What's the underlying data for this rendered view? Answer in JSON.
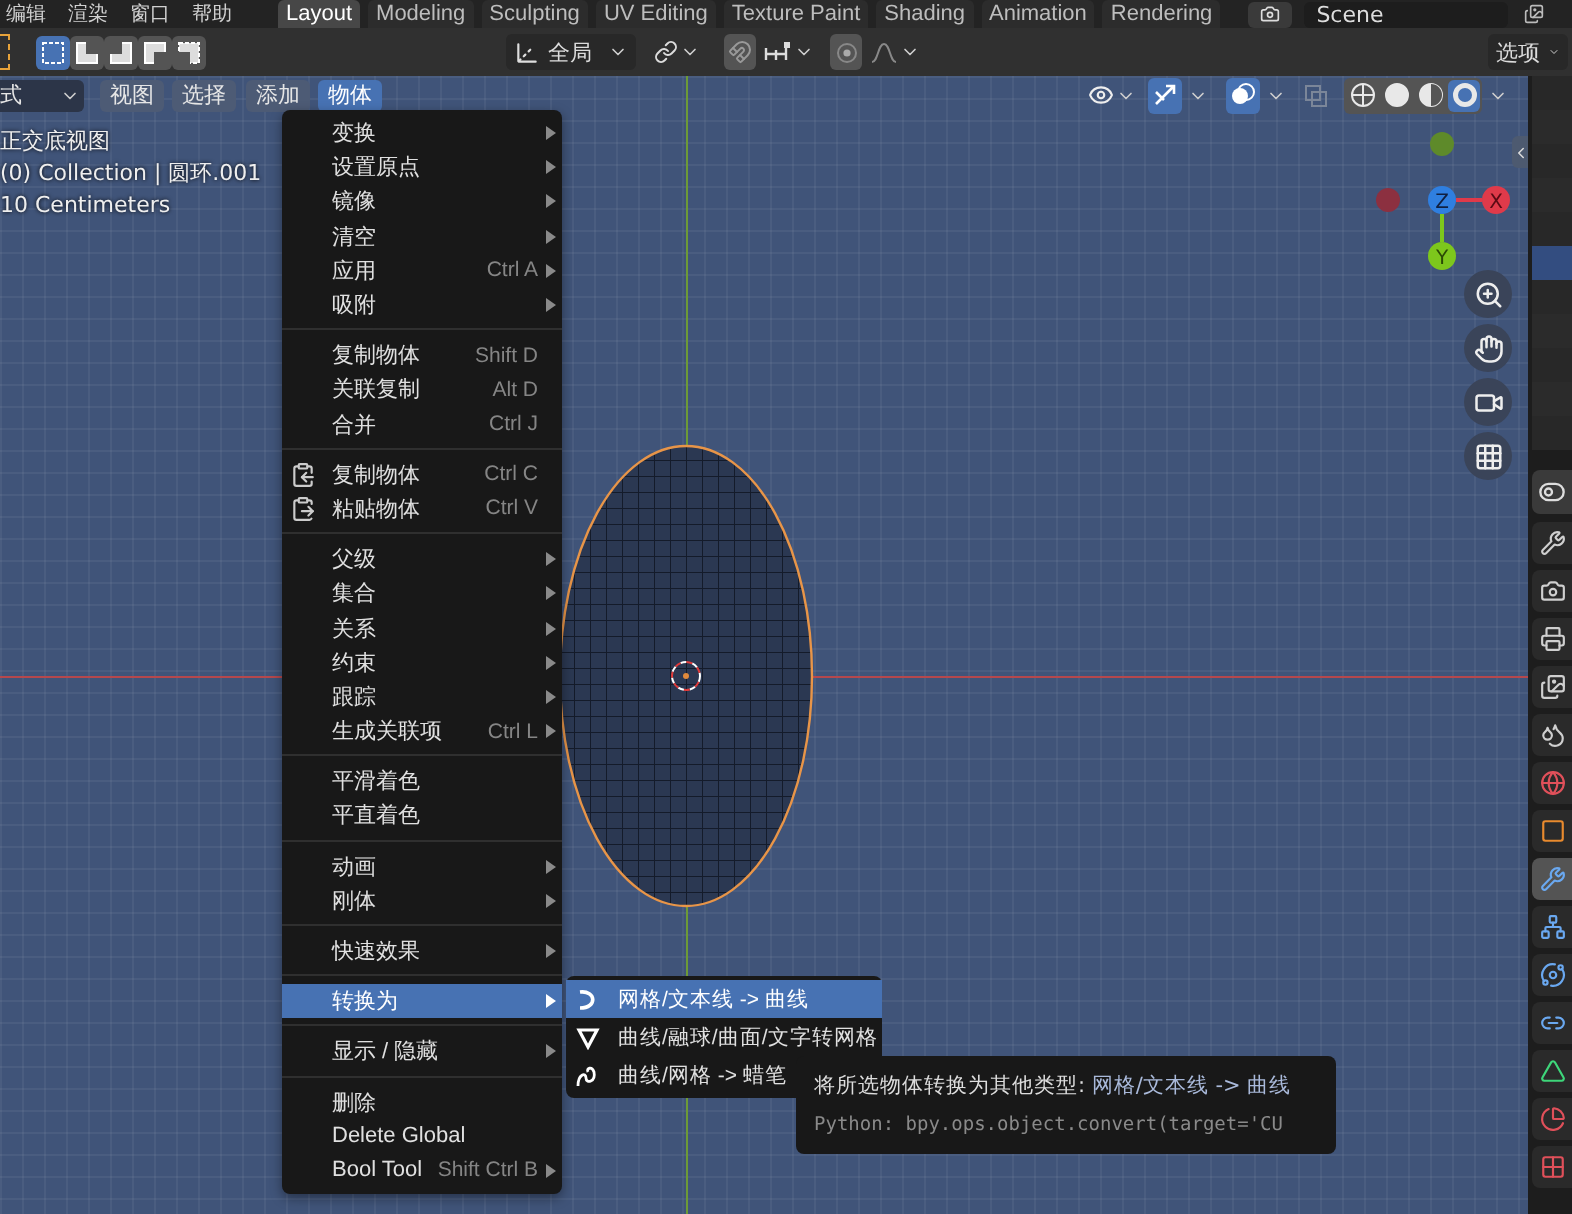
{
  "top_menu": [
    "编辑",
    "渲染",
    "窗口",
    "帮助"
  ],
  "workspace_tabs": [
    {
      "label": "Layout",
      "selected": true
    },
    {
      "label": "Modeling",
      "selected": false
    },
    {
      "label": "Sculpting",
      "selected": false
    },
    {
      "label": "UV Editing",
      "selected": false
    },
    {
      "label": "Texture Paint",
      "selected": false
    },
    {
      "label": "Shading",
      "selected": false
    },
    {
      "label": "Animation",
      "selected": false
    },
    {
      "label": "Rendering",
      "selected": false
    }
  ],
  "scene": {
    "value": "Scene"
  },
  "tool_header": {
    "select_modes": [
      {
        "selected": true
      },
      {
        "selected": false
      },
      {
        "selected": false
      },
      {
        "selected": false
      },
      {
        "selected": false
      }
    ],
    "orientation": "全局",
    "options": "选项"
  },
  "view_header": {
    "mode": "式",
    "menus": [
      {
        "label": "视图",
        "selected": false
      },
      {
        "label": "选择",
        "selected": false
      },
      {
        "label": "添加",
        "selected": false
      },
      {
        "label": "物体",
        "selected": true
      }
    ],
    "gizmos_on": true,
    "overlays_on": true,
    "xray_on": false,
    "shading_modes": [
      {
        "selected": false
      },
      {
        "selected": false
      },
      {
        "selected": false
      },
      {
        "selected": true
      }
    ]
  },
  "viewport_info": [
    "正交底视图",
    "(0) Collection | 圆环.001",
    "10 Centimeters"
  ],
  "gizmo": {
    "axes": [
      {
        "label": "Z"
      },
      {
        "label": "X"
      },
      {
        "label": "Y"
      }
    ]
  },
  "object_menu": {
    "groups": [
      [
        {
          "label": "变换",
          "submenu": true,
          "selected": false
        },
        {
          "label": "设置原点",
          "submenu": true,
          "selected": false
        },
        {
          "label": "镜像",
          "submenu": true,
          "selected": false
        },
        {
          "label": "清空",
          "submenu": true,
          "selected": false
        },
        {
          "label": "应用",
          "shortcut": "Ctrl A",
          "submenu": true,
          "selected": false
        },
        {
          "label": "吸附",
          "submenu": true,
          "selected": false
        }
      ],
      [
        {
          "label": "复制物体",
          "shortcut": "Shift D",
          "submenu": false,
          "selected": false
        },
        {
          "label": "关联复制",
          "shortcut": "Alt D",
          "submenu": false,
          "selected": false
        },
        {
          "label": "合并",
          "shortcut": "Ctrl J",
          "submenu": false,
          "selected": false
        }
      ],
      [
        {
          "label": "复制物体",
          "shortcut": "Ctrl C",
          "submenu": false,
          "selected": false
        },
        {
          "label": "粘贴物体",
          "shortcut": "Ctrl V",
          "submenu": false,
          "selected": false
        }
      ],
      [
        {
          "label": "父级",
          "submenu": true,
          "selected": false
        },
        {
          "label": "集合",
          "submenu": true,
          "selected": false
        },
        {
          "label": "关系",
          "submenu": true,
          "selected": false
        },
        {
          "label": "约束",
          "submenu": true,
          "selected": false
        },
        {
          "label": "跟踪",
          "submenu": true,
          "selected": false
        },
        {
          "label": "生成关联项",
          "shortcut": "Ctrl L",
          "submenu": true,
          "selected": false
        }
      ],
      [
        {
          "label": "平滑着色",
          "submenu": false,
          "selected": false
        },
        {
          "label": "平直着色",
          "submenu": false,
          "selected": false
        }
      ],
      [
        {
          "label": "动画",
          "submenu": true,
          "selected": false
        },
        {
          "label": "刚体",
          "submenu": true,
          "selected": false
        }
      ],
      [
        {
          "label": "快速效果",
          "submenu": true,
          "selected": false
        }
      ],
      [
        {
          "label": "转换为",
          "submenu": true,
          "selected": true
        }
      ],
      [
        {
          "label": "显示 / 隐藏",
          "submenu": true,
          "selected": false
        }
      ],
      [
        {
          "label": "删除",
          "submenu": false,
          "selected": false
        },
        {
          "label": "Delete Global",
          "submenu": false,
          "selected": false
        },
        {
          "label": "Bool Tool",
          "shortcut": "Shift Ctrl B",
          "submenu": true,
          "selected": false
        }
      ]
    ]
  },
  "convert_submenu": {
    "items": [
      {
        "kind": "curve",
        "label": "网格/文本线 -> 曲线",
        "selected": true
      },
      {
        "kind": "mesh",
        "label": "曲线/融球/曲面/文字转网格",
        "selected": false
      },
      {
        "kind": "pencil",
        "label": "曲线/网格 -> 蜡笔",
        "selected": false
      }
    ]
  },
  "tooltip": {
    "description": "将所选物体转换为其他类型: ",
    "value": "网格/文本线 -> 曲线",
    "python": "Python: bpy.ops.object.convert(target='CU"
  },
  "outliner": {
    "rows": [
      {
        "selected": false
      },
      {
        "selected": false
      },
      {
        "selected": false
      },
      {
        "selected": false
      },
      {
        "selected": false
      },
      {
        "selected": true
      },
      {
        "selected": false
      },
      {
        "selected": false
      },
      {
        "selected": false
      },
      {
        "selected": false
      },
      {
        "selected": false
      }
    ]
  },
  "properties_tabs": [
    {
      "kind": "tool",
      "selected": false
    },
    {
      "kind": "render",
      "selected": false
    },
    {
      "kind": "output",
      "selected": false
    },
    {
      "kind": "view-layer",
      "selected": false
    },
    {
      "kind": "scene",
      "selected": false
    },
    {
      "kind": "world",
      "selected": false
    },
    {
      "kind": "object",
      "selected": false
    },
    {
      "kind": "modifier",
      "selected": true
    },
    {
      "kind": "particles",
      "selected": false
    },
    {
      "kind": "physics",
      "selected": false
    },
    {
      "kind": "constraints",
      "selected": false
    },
    {
      "kind": "data",
      "selected": false
    },
    {
      "kind": "material",
      "selected": false
    },
    {
      "kind": "texture",
      "selected": false
    }
  ]
}
